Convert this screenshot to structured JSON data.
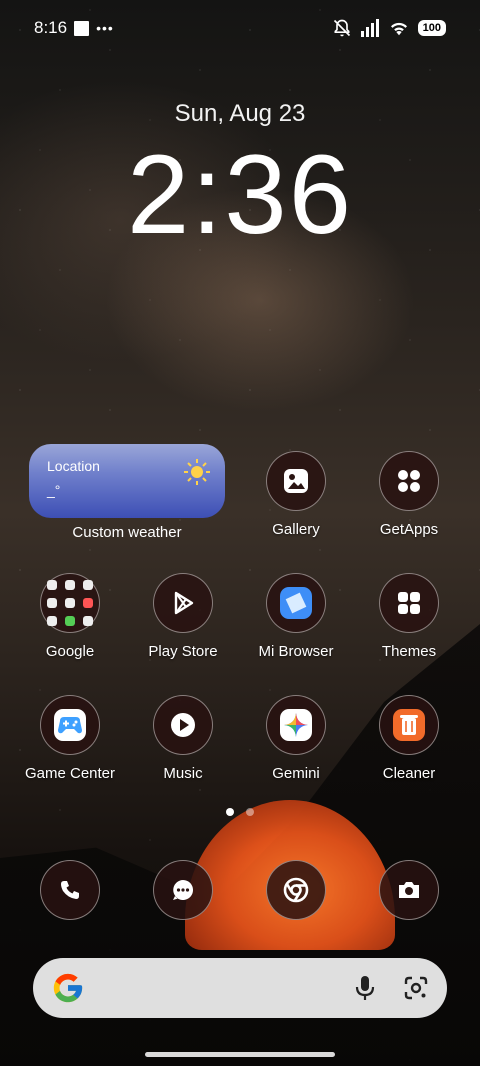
{
  "status_bar": {
    "time": "8:16",
    "more_dots": "•••",
    "battery": "100"
  },
  "clock": {
    "date": "Sun, Aug 23",
    "time": "2:36"
  },
  "weather_widget": {
    "location": "Location",
    "temperature": "_°",
    "label": "Custom weather"
  },
  "apps": {
    "gallery": "Gallery",
    "getapps": "GetApps",
    "google": "Google",
    "play_store": "Play Store",
    "mi_browser": "Mi Browser",
    "themes": "Themes",
    "game_center": "Game Center",
    "music": "Music",
    "gemini": "Gemini",
    "cleaner": "Cleaner"
  },
  "dock": [
    "phone",
    "messages",
    "chrome",
    "camera"
  ],
  "page_indicator": {
    "pages": 2,
    "current": 1
  },
  "colors": {
    "icon_bg": "#281210",
    "weather_top": "#9aa6d8",
    "weather_bottom": "#3d4fb5",
    "search_bar": "#ebebeb"
  }
}
